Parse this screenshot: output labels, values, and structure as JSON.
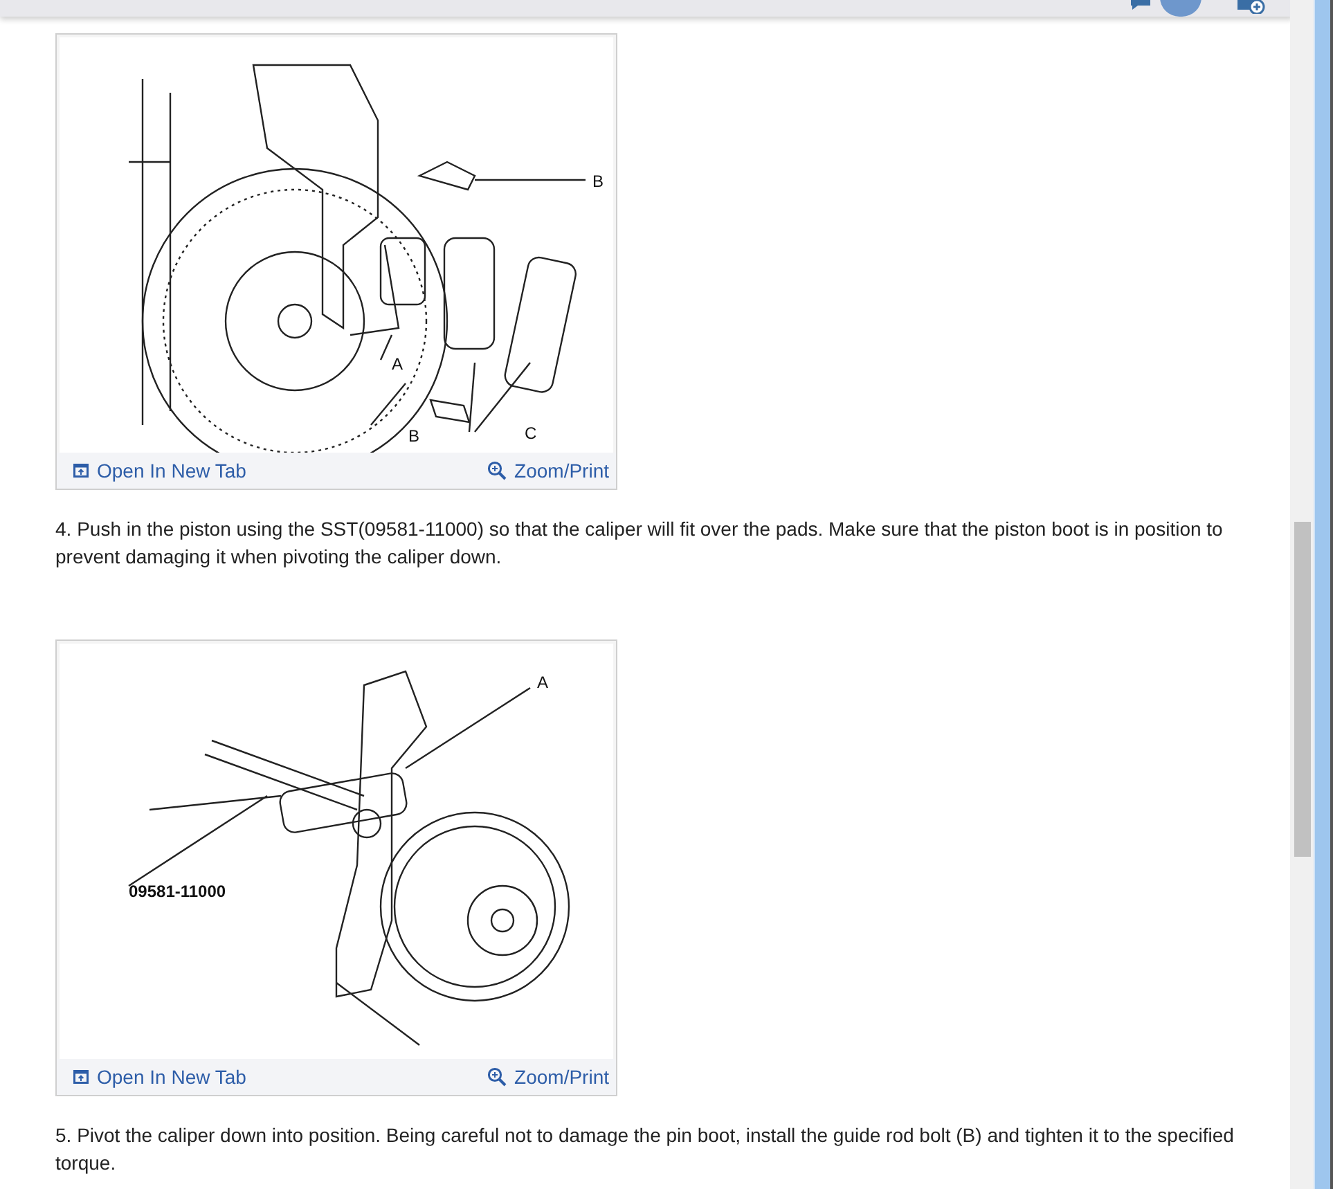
{
  "figures": [
    {
      "kind": "pads",
      "labels": [
        "B",
        "A",
        "B",
        "C"
      ],
      "open_link": "Open In New Tab",
      "zoom_link": "Zoom/Print"
    },
    {
      "kind": "piston",
      "labels": [
        "A",
        "09581-11000"
      ],
      "open_link": "Open In New Tab",
      "zoom_link": "Zoom/Print"
    }
  ],
  "steps": [
    "4. Push in the piston using the SST(09581-11000) so that the caliper will fit over the pads. Make sure that the piston boot is in position to prevent damaging it when pivoting the caliper down.",
    "5. Pivot the caliper down into position. Being careful not to damage the pin boot, install the guide rod bolt (B) and tighten it to the specified torque."
  ]
}
